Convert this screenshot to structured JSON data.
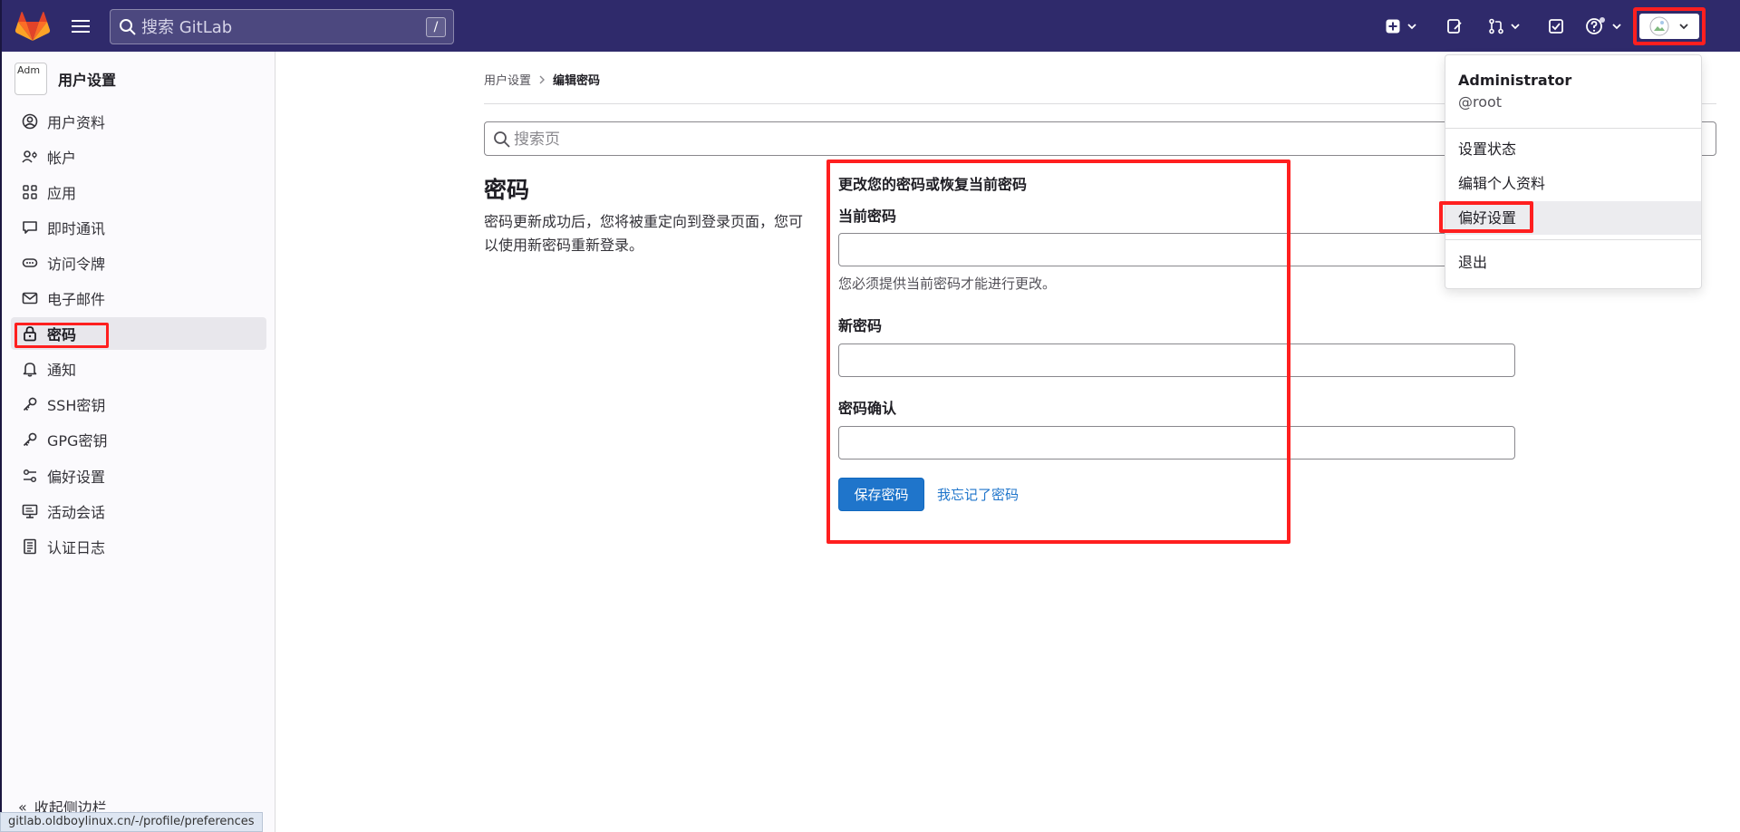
{
  "topbar": {
    "search_placeholder": "搜索 GitLab",
    "search_shortcut": "/"
  },
  "sidebar": {
    "title": "用户设置",
    "avatar_alt": "Adm",
    "items": [
      {
        "label": "用户资料",
        "icon": "user-icon"
      },
      {
        "label": "帐户",
        "icon": "account-icon"
      },
      {
        "label": "应用",
        "icon": "applications-icon"
      },
      {
        "label": "即时通讯",
        "icon": "chat-icon"
      },
      {
        "label": "访问令牌",
        "icon": "token-icon"
      },
      {
        "label": "电子邮件",
        "icon": "mail-icon"
      },
      {
        "label": "密码",
        "icon": "lock-icon",
        "active": true
      },
      {
        "label": "通知",
        "icon": "bell-icon"
      },
      {
        "label": "SSH密钥",
        "icon": "key-icon"
      },
      {
        "label": "GPG密钥",
        "icon": "key-icon"
      },
      {
        "label": "偏好设置",
        "icon": "preferences-icon"
      },
      {
        "label": "活动会话",
        "icon": "monitor-icon"
      },
      {
        "label": "认证日志",
        "icon": "log-icon"
      }
    ],
    "collapse_label": "收起侧边栏"
  },
  "status_url": "gitlab.oldboylinux.cn/-/profile/preferences",
  "breadcrumb": {
    "parent": "用户设置",
    "current": "编辑密码"
  },
  "page_search_placeholder": "搜索页",
  "section": {
    "title": "密码",
    "description": "密码更新成功后，您将被重定向到登录页面，您可以使用新密码重新登录。"
  },
  "form": {
    "heading": "更改您的密码或恢复当前密码",
    "current_password_label": "当前密码",
    "current_password_help": "您必须提供当前密码才能进行更改。",
    "new_password_label": "新密码",
    "confirm_password_label": "密码确认",
    "save_button": "保存密码",
    "forgot_link": "我忘记了密码"
  },
  "user_menu": {
    "name": "Administrator",
    "handle": "@root",
    "items": [
      "设置状态",
      "编辑个人资料",
      "偏好设置",
      "退出"
    ]
  },
  "colors": {
    "topbar": "#2f2a6b",
    "accent": "#1f75cb",
    "highlight": "#ff1f1f"
  }
}
